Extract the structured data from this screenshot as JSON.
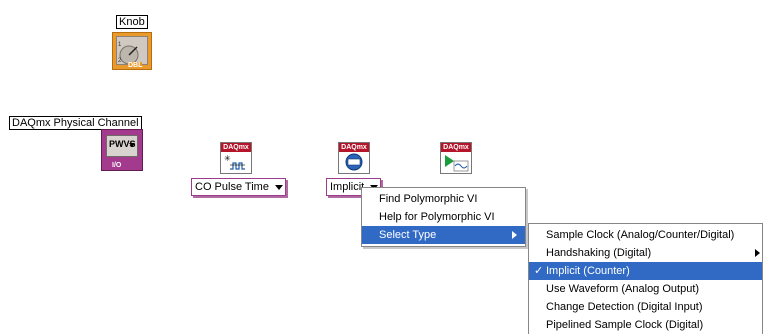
{
  "knob": {
    "label": "Knob",
    "badge": "DBL"
  },
  "physical_channel": {
    "label": "DAQmx Physical Channel",
    "value": "PWVS",
    "io_badge": "I/O"
  },
  "daqmx_badge": "DAQmx",
  "selectors": {
    "co_pulse_time": "CO Pulse Time",
    "implicit": "Implicit"
  },
  "context_menu": {
    "items": [
      {
        "label": "Find Polymorphic VI"
      },
      {
        "label": "Help for Polymorphic VI"
      },
      {
        "label": "Select Type"
      }
    ]
  },
  "submenu": {
    "items": [
      {
        "label": "Sample Clock (Analog/Counter/Digital)"
      },
      {
        "label": "Handshaking (Digital)"
      },
      {
        "label": "Implicit (Counter)",
        "checked": true
      },
      {
        "label": "Use Waveform (Analog Output)"
      },
      {
        "label": "Change Detection (Digital Input)"
      },
      {
        "label": "Pipelined Sample Clock (Digital)"
      }
    ]
  },
  "colors": {
    "control_orange": "#e99a2b",
    "daqmx_purple": "#a43a8e",
    "daqmx_red": "#b5152b",
    "menu_highlight": "#316ac5"
  }
}
